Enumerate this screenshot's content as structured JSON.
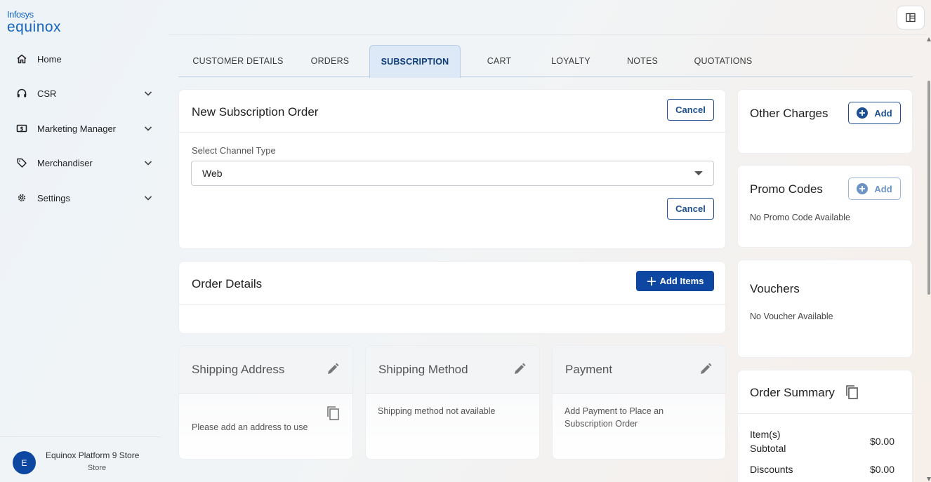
{
  "brand": {
    "line1": "Infosys",
    "line2": "equinox"
  },
  "sidebar": {
    "items": [
      {
        "label": "Home",
        "icon": "home-icon",
        "has_chevron": false
      },
      {
        "label": "CSR",
        "icon": "headset-icon",
        "has_chevron": true
      },
      {
        "label": "Marketing Manager",
        "icon": "dollar-bill-icon",
        "has_chevron": true
      },
      {
        "label": "Merchandiser",
        "icon": "tag-icon",
        "has_chevron": true
      },
      {
        "label": "Settings",
        "icon": "gear-icon",
        "has_chevron": true
      }
    ],
    "store": {
      "initial": "E",
      "name": "Equinox Platform 9 Store",
      "type": "Store"
    }
  },
  "tabs": [
    {
      "label": "CUSTOMER DETAILS",
      "active": false
    },
    {
      "label": "ORDERS",
      "active": false
    },
    {
      "label": "SUBSCRIPTION",
      "active": true
    },
    {
      "label": "CART",
      "active": false
    },
    {
      "label": "LOYALTY",
      "active": false
    },
    {
      "label": "NOTES",
      "active": false
    },
    {
      "label": "QUOTATIONS",
      "active": false
    }
  ],
  "new_order": {
    "title": "New Subscription Order",
    "cancel_label": "Cancel",
    "channel_label": "Select Channel Type",
    "channel_value": "Web",
    "cancel_label_2": "Cancel"
  },
  "order_details": {
    "title": "Order Details",
    "add_items_label": "Add Items"
  },
  "shipping_address": {
    "title": "Shipping Address",
    "body": "Please add an address to use"
  },
  "shipping_method": {
    "title": "Shipping Method",
    "body": "Shipping method not available"
  },
  "payment": {
    "title": "Payment",
    "body": "Add Payment to Place an Subscription Order"
  },
  "other_charges": {
    "title": "Other Charges",
    "add_label": "Add"
  },
  "promo_codes": {
    "title": "Promo Codes",
    "add_label": "Add",
    "empty": "No Promo Code Available"
  },
  "vouchers": {
    "title": "Vouchers",
    "empty": "No Voucher Available"
  },
  "order_summary": {
    "title": "Order Summary",
    "rows": [
      {
        "label": "Item(s) Subtotal",
        "value": "$0.00"
      },
      {
        "label": "Discounts",
        "value": "$0.00"
      }
    ]
  },
  "colors": {
    "accent": "#0d47a1",
    "tab_active_bg": "#dde9f6"
  }
}
